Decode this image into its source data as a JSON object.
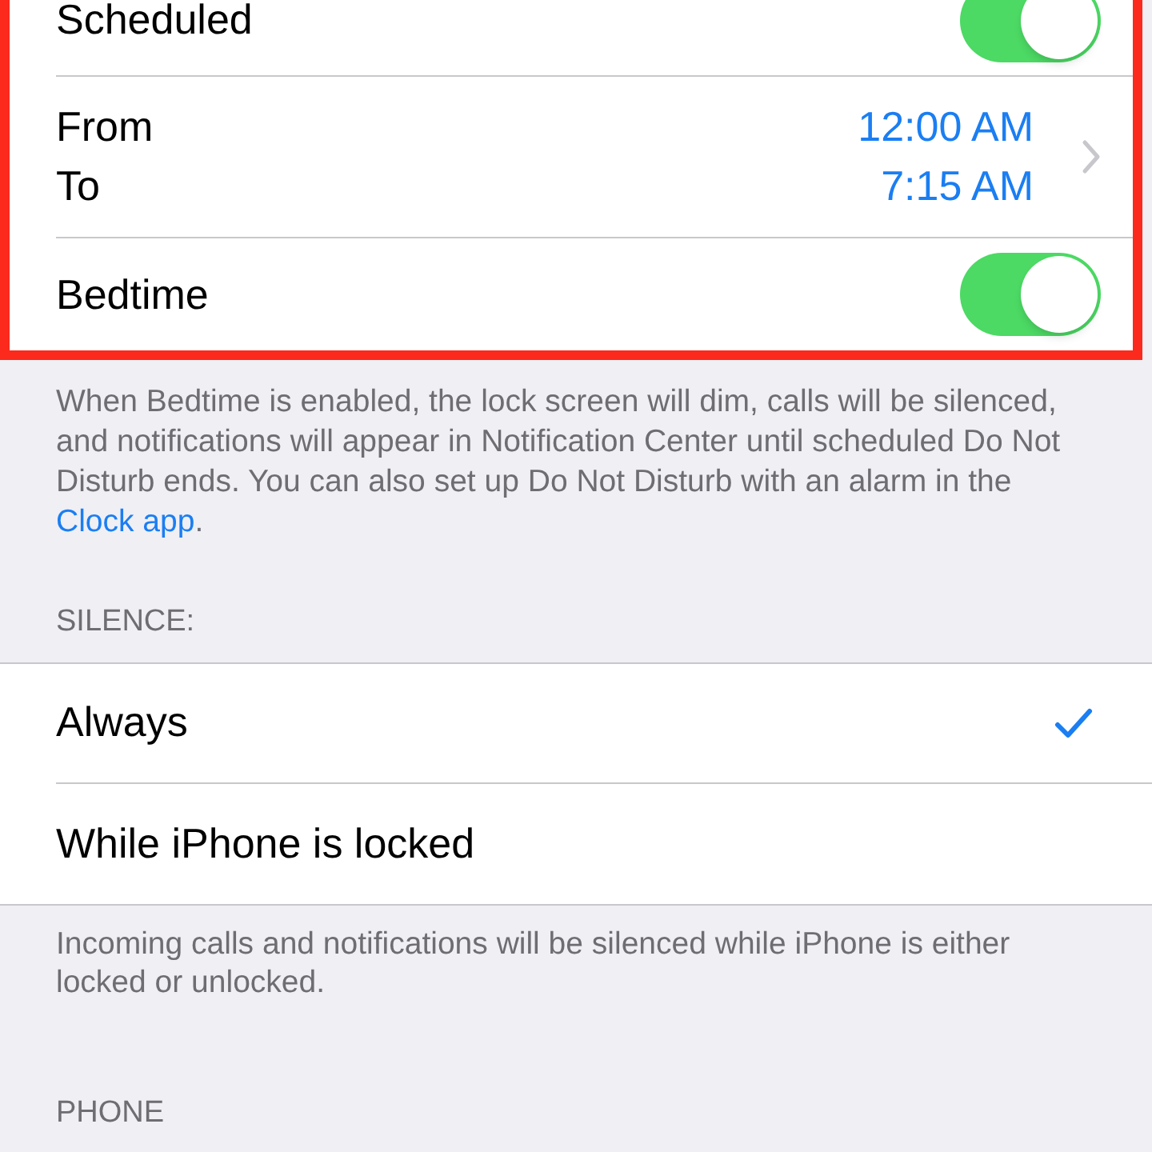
{
  "schedule_section": {
    "highlighted": true,
    "rows": [
      {
        "kind": "toggle",
        "label": "Scheduled",
        "on": true
      },
      {
        "kind": "range",
        "from_label": "From",
        "from_value": "12:00 AM",
        "to_label": "To",
        "to_value": "7:15 AM"
      },
      {
        "kind": "toggle",
        "label": "Bedtime",
        "on": true
      }
    ]
  },
  "bedtime_note": {
    "text": "When Bedtime is enabled, the lock screen will dim, calls will be silenced, and notifications will appear in Notification Center until scheduled Do Not Disturb ends. You can also set up Do Not Disturb with an alarm in the ",
    "link": "Clock app",
    "end": "."
  },
  "silence": {
    "header": "SILENCE:",
    "options": [
      {
        "label": "Always",
        "selected": true
      },
      {
        "label": "While iPhone is locked",
        "selected": false
      }
    ],
    "footer": "Incoming calls and notifications will be silenced while iPhone is either locked or unlocked."
  },
  "phone": {
    "header": "PHONE"
  }
}
